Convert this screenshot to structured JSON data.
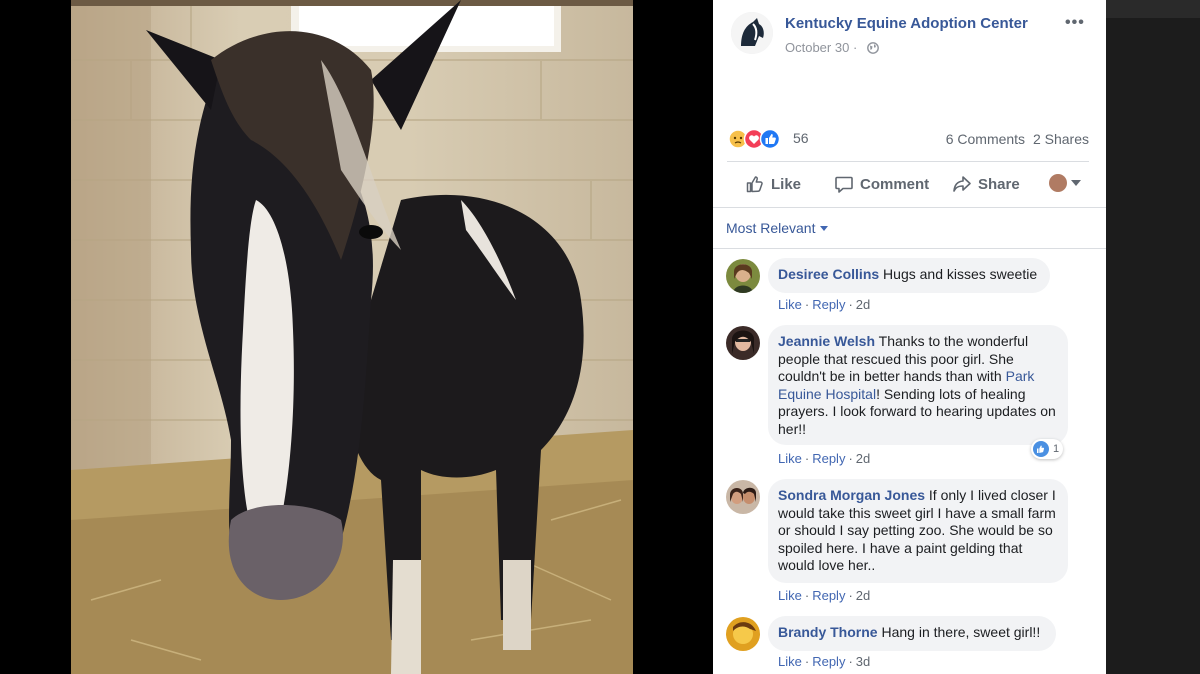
{
  "post": {
    "page_name": "Kentucky Equine Adoption Center",
    "date": "October 30",
    "separator": "·",
    "more_glyph": "•••",
    "reactions": {
      "icons": [
        "sad-reaction-icon",
        "love-reaction-icon",
        "like-reaction-icon"
      ],
      "count": "56"
    },
    "comments_count": "6 Comments",
    "shares_count": "2 Shares",
    "actions": {
      "like_label": "Like",
      "comment_label": "Comment",
      "share_label": "Share"
    },
    "sort_label": "Most Relevant"
  },
  "comments": [
    {
      "author": "Desiree Collins",
      "text": "Hugs and kisses sweetie",
      "like": "Like",
      "reply": "Reply",
      "age": "2d"
    },
    {
      "author": "Jeannie Welsh",
      "text_before": "Thanks to the wonderful people that rescued this poor girl. She couldn't be in better hands than with",
      "link": "Park Equine Hospital",
      "text_after": "! Sending lots of healing prayers. I look forward to hearing updates on her!!",
      "like": "Like",
      "reply": "Reply",
      "age": "2d",
      "like_count": "1"
    },
    {
      "author": "Sondra Morgan Jones",
      "text": "If only I lived closer I would take this sweet girl I have a small farm or should I say petting zoo. She would be so spoiled here. I have a paint gelding that would love her..",
      "like": "Like",
      "reply": "Reply",
      "age": "2d"
    },
    {
      "author": "Brandy Thorne",
      "text": "Hang in there, sweet girl!!",
      "like": "Like",
      "reply": "Reply",
      "age": "3d"
    }
  ],
  "colors": {
    "link_blue": "#385898",
    "action_blue": "#4267b2",
    "bubble_gray": "#f2f3f5",
    "meta_gray": "#90949c"
  }
}
